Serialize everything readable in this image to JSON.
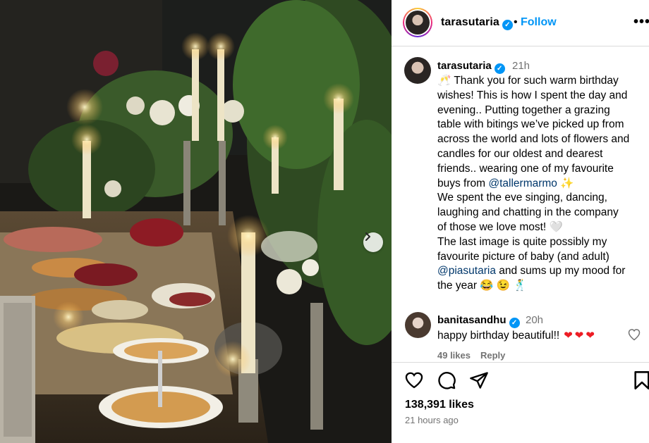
{
  "header": {
    "username": "tarasutaria",
    "verified_mark": "✓",
    "separator": "•",
    "follow_label": "Follow",
    "more_label": "•••"
  },
  "caption": {
    "username": "tarasutaria",
    "verified_mark": "✓",
    "time": "21h",
    "lines": [
      {
        "pre": "🥂 Thank you for such warm birthday",
        "mention": "",
        "post": ""
      },
      {
        "pre": "wishes! This is how I spent the day and",
        "mention": "",
        "post": ""
      },
      {
        "pre": "evening.. Putting together a grazing",
        "mention": "",
        "post": ""
      },
      {
        "pre": "table with bitings we’ve picked up from",
        "mention": "",
        "post": ""
      },
      {
        "pre": "across the world and lots of flowers and",
        "mention": "",
        "post": ""
      },
      {
        "pre": "candles for our oldest and dearest",
        "mention": "",
        "post": ""
      },
      {
        "pre": "friends.. wearing one of my favourite",
        "mention": "",
        "post": ""
      },
      {
        "pre": "buys from ",
        "mention": "@tallermarmo",
        "post": " ✨"
      },
      {
        "pre": "We spent the eve singing, dancing,",
        "mention": "",
        "post": ""
      },
      {
        "pre": "laughing and chatting in the company",
        "mention": "",
        "post": ""
      },
      {
        "pre": "of those we love most! 🤍",
        "mention": "",
        "post": ""
      },
      {
        "pre": "The last image is quite possibly my",
        "mention": "",
        "post": ""
      },
      {
        "pre": "favourite picture of baby (and adult)",
        "mention": "",
        "post": ""
      },
      {
        "pre": "",
        "mention": "@piasutaria",
        "post": " and sums up my mood for"
      },
      {
        "pre": "the year 😂 😉 🕺",
        "mention": "",
        "post": ""
      }
    ]
  },
  "comment": {
    "username": "banitasandhu",
    "verified_mark": "✓",
    "time": "20h",
    "text": "happy birthday beautiful!!",
    "hearts": "❤❤❤",
    "likes": "49 likes",
    "reply_label": "Reply"
  },
  "actions": {
    "likes_count": "138,391 likes",
    "posted_time": "21 hours ago"
  },
  "photo": {
    "description_icon": "candle-grazing-table-photo",
    "carousel_next_icon": "chevron-right-icon"
  },
  "colors": {
    "accent_blue": "#0095f6",
    "mention_blue": "#00376b",
    "muted_gray": "#737373",
    "heart_red": "#ed1c24",
    "divider": "#dbdbdb"
  }
}
